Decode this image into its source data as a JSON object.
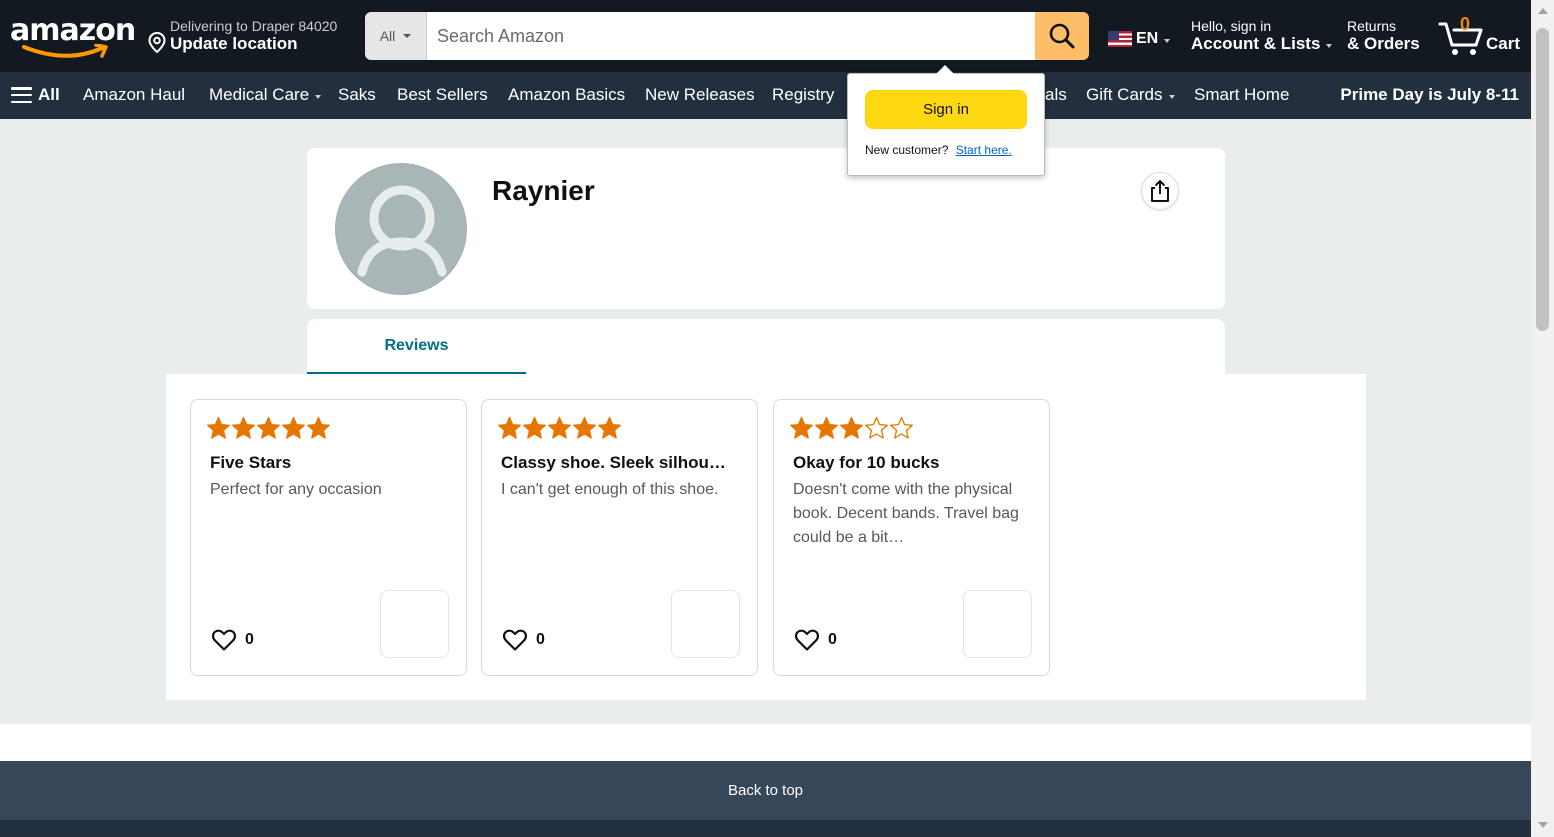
{
  "header": {
    "logo_text": "amazon",
    "deliver_line1": "Delivering to Draper 84020",
    "deliver_line2": "Update location",
    "search_category": "All",
    "search_placeholder": "Search Amazon",
    "language": "EN",
    "account_line1": "Hello, sign in",
    "account_line2": "Account & Lists",
    "orders_line1": "Returns",
    "orders_line2": "& Orders",
    "cart_count": "0",
    "cart_label": "Cart",
    "icons": {
      "location": "location-pin-icon",
      "search": "search-icon",
      "flag": "us-flag-icon",
      "cart": "cart-icon"
    }
  },
  "nav": {
    "all_label": "All",
    "items": [
      {
        "label": "Amazon Haul"
      },
      {
        "label": "Medical Care"
      },
      {
        "label": "Saks"
      },
      {
        "label": "Best Sellers"
      },
      {
        "label": "Amazon Basics"
      },
      {
        "label": "New Releases"
      },
      {
        "label": "Registry"
      },
      {
        "label": "als"
      },
      {
        "label": "Gift Cards"
      },
      {
        "label": "Smart Home"
      }
    ],
    "promo": "Prime Day is July 8-11"
  },
  "flyout": {
    "signin_label": "Sign in",
    "new_customer": "New customer?",
    "start_here": "Start here."
  },
  "profile": {
    "name": "Raynier",
    "tab_label": "Reviews",
    "icons": {
      "avatar": "default-avatar-icon",
      "share": "share-icon"
    }
  },
  "reviews": [
    {
      "rating": 5,
      "title": "Five Stars",
      "body": "Perfect for any occasion",
      "likes": "0"
    },
    {
      "rating": 5,
      "title": "Classy shoe. Sleek silhou…",
      "body": "I can't get enough of this shoe.",
      "likes": "0"
    },
    {
      "rating": 3,
      "title": "Okay for 10 bucks",
      "body": "Doesn't come with the physical book. Decent bands. Travel bag could be a bit…",
      "likes": "0"
    }
  ],
  "footer": {
    "back_to_top": "Back to top"
  },
  "colors": {
    "header_bg": "#131921",
    "nav_bg": "#232f3e",
    "search_button": "#febd69",
    "signin_button": "#ffd814",
    "star": "#e77600",
    "tab_accent": "#007185",
    "back_to_top_bg": "#37475a"
  }
}
